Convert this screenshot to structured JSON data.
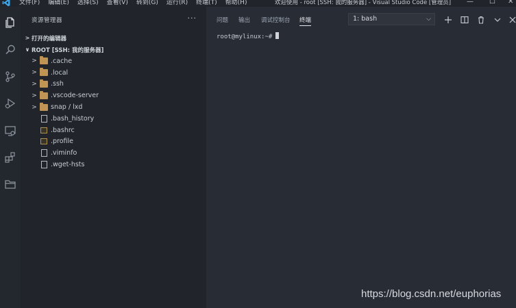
{
  "titlebar": {
    "menu": [
      "文件(F)",
      "编辑(E)",
      "选择(S)",
      "查看(V)",
      "转到(G)",
      "运行(R)",
      "终端(T)",
      "帮助(H)"
    ],
    "window_title": "欢迎使用 - root [SSH: 我的服务器] - Visual Studio Code [管理员]"
  },
  "activity_bar": {
    "icons": [
      "explorer-icon",
      "search-icon",
      "source-control-icon",
      "run-debug-icon",
      "remote-explorer-icon",
      "extensions-icon",
      "folder-icon"
    ]
  },
  "sidebar": {
    "title": "资源管理器",
    "more": "···",
    "open_editors": "打开的编辑器",
    "root_label": "ROOT [SSH: 我的服务器]",
    "items": [
      {
        "name": ".cache",
        "type": "folder"
      },
      {
        "name": ".local",
        "type": "folder"
      },
      {
        "name": ".ssh",
        "type": "folder"
      },
      {
        "name": ".vscode-server",
        "type": "folder"
      },
      {
        "name": "snap / lxd",
        "type": "folder"
      },
      {
        "name": ".bash_history",
        "type": "file"
      },
      {
        "name": ".bashrc",
        "type": "shell"
      },
      {
        "name": ".profile",
        "type": "shell"
      },
      {
        "name": ".viminfo",
        "type": "file"
      },
      {
        "name": ".wget-hsts",
        "type": "file"
      }
    ]
  },
  "panel": {
    "tabs": [
      "问题",
      "输出",
      "调试控制台",
      "终端"
    ],
    "active_tab": "终端",
    "terminal_select": "1: bash",
    "prompt": "root@mylinux:~#"
  },
  "watermark": "https://blog.csdn.net/euphorias",
  "colors": {
    "folder": "#c09553",
    "sidebar_bg": "#21252b",
    "panel_bg": "#282c34",
    "accent": "#007acc"
  }
}
